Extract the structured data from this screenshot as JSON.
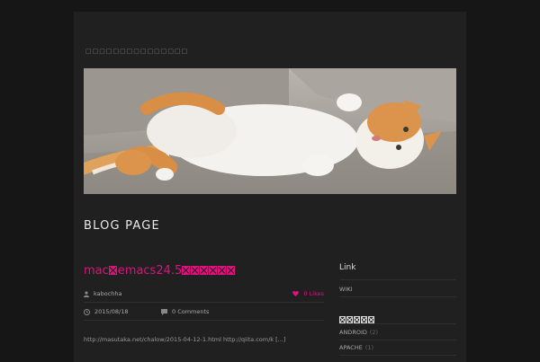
{
  "site": {
    "title": "□□□□□□□□□□□□□□□"
  },
  "page_heading": "BLOG PAGE",
  "post": {
    "title_prefix": "mac",
    "title_middle": "emacs24.5",
    "author": "kabochha",
    "likes": "0 Likes",
    "date": "2015/08/18",
    "comments": "0 Comments",
    "excerpt": "http://masutaka.net/chalow/2015-04-12-1.html  http://qiita.com/k [...]"
  },
  "sidebar": {
    "link_heading": "Link",
    "links": [
      {
        "label": "WIKI"
      }
    ],
    "categories": [
      {
        "label": "ANDROID",
        "count": "(2)"
      },
      {
        "label": "APACHE",
        "count": "(1)"
      }
    ]
  },
  "colors": {
    "accent": "#e0107f",
    "background": "#161616",
    "panel": "#202020"
  },
  "icons": {
    "author": "user-icon",
    "likes": "heart-icon",
    "date": "clock-icon",
    "comments": "comment-icon"
  }
}
